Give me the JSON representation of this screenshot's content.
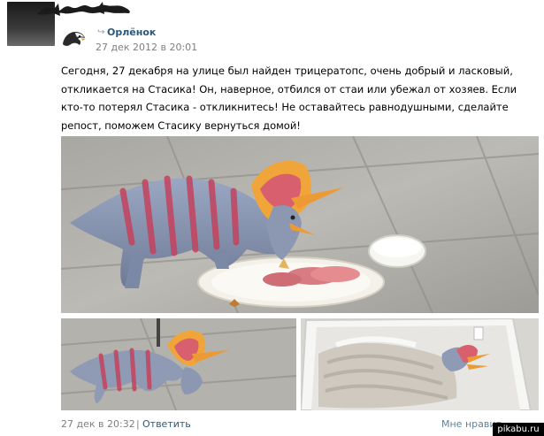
{
  "post": {
    "group_name": "Орлёнок",
    "date": "27 дек 2012 в 20:01",
    "text": "Сегодня, 27 декабря на улице был найден трицератопс, очень добрый и ласковый, откликается на Стасика! Он, наверное, отбился от стаи или убежал от хозяев. Если кто-то потерял Стасика - откликнитесь! Не оставайтесь равнодушными, сделайте репост, поможем Стасику вернуться домой!"
  },
  "icons": {
    "repost": "repost-icon",
    "group_avatar": "eagle-icon"
  },
  "footer": {
    "date": "27 дек в 20:32",
    "separator": "|",
    "reply_label": "Ответить",
    "like_label": "Мне нравит"
  },
  "watermark": "pikabu.ru",
  "colors": {
    "link": "#2b587a",
    "muted": "#7f7f7f",
    "triceratops_body": "#8f9bb5",
    "triceratops_stripes": "#c4435e",
    "frill_orange": "#f0a53a"
  }
}
